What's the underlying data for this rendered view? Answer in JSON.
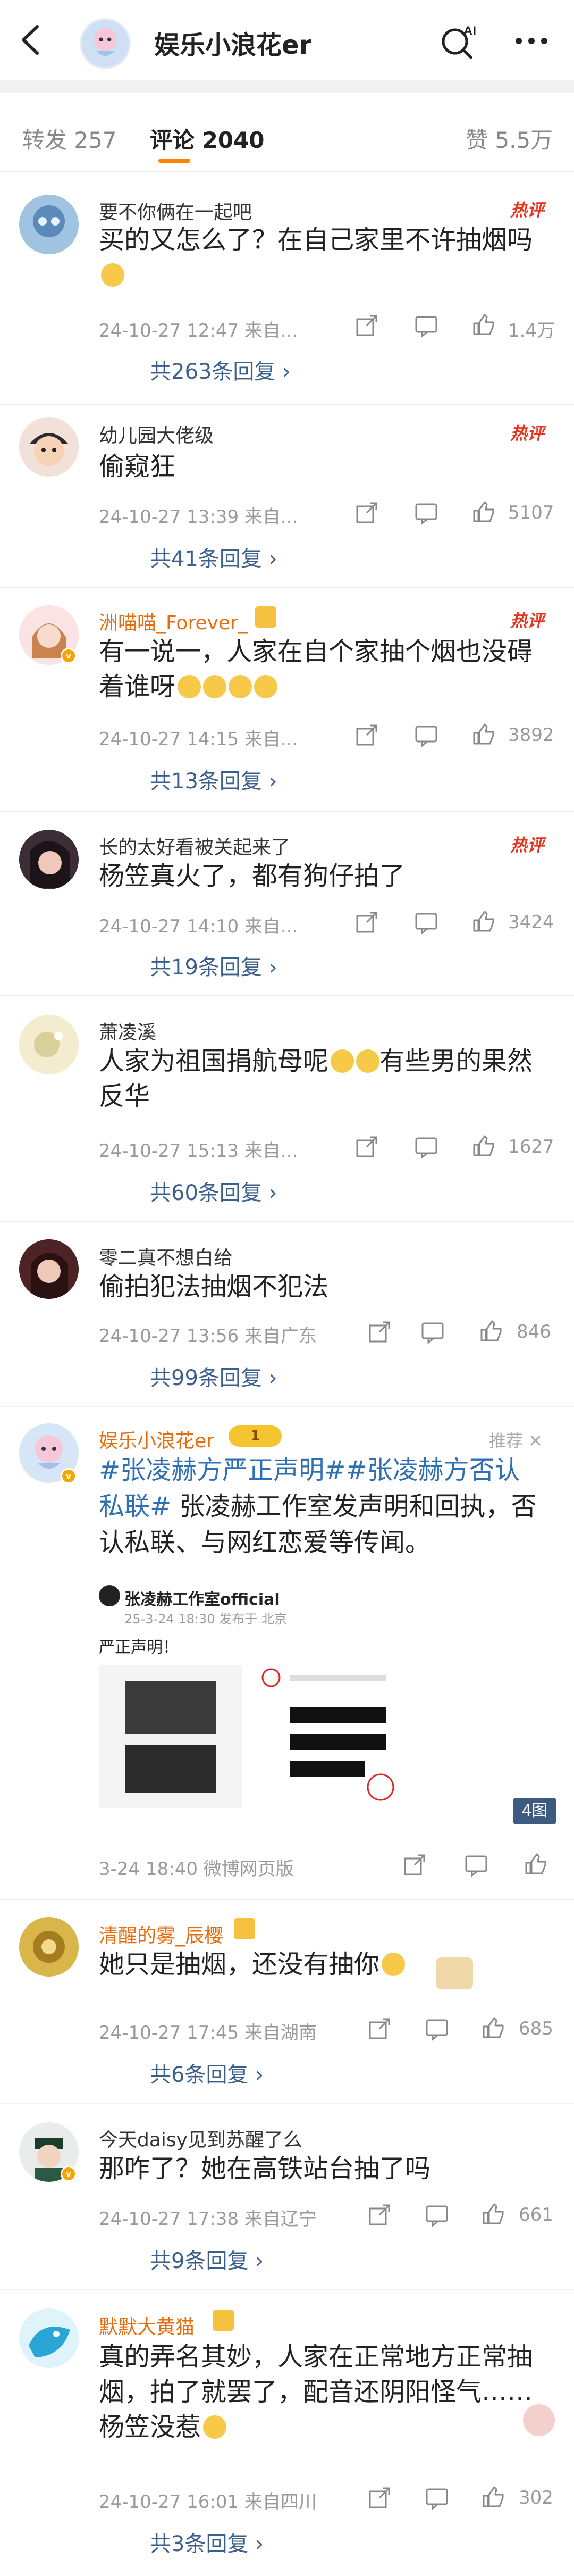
{
  "header": {
    "title": "娱乐小浪花er",
    "ai_label": "AI"
  },
  "tabs": [
    {
      "label": "转发 257"
    },
    {
      "label": "评论 2040"
    },
    {
      "label": "赞 5.5万"
    }
  ],
  "hot_label": "热评",
  "comments": [
    {
      "name": "要不你俩在一起吧",
      "text": "买的又怎么了？在自己家里不许抽烟吗",
      "meta": "24-10-27 12:47  来自...",
      "likes": "1.4万",
      "replies": "共263条回复 ›"
    },
    {
      "name": "幼儿园大佬级",
      "text": "偷窥狂",
      "meta": "24-10-27 13:39  来自...",
      "likes": "5107",
      "replies": "共41条回复 ›"
    },
    {
      "name": "洲喵喵_Forever_",
      "text": "有一说一，人家在自个家抽个烟也没碍着谁呀",
      "meta": "24-10-27 14:15  来自...",
      "likes": "3892",
      "replies": "共13条回复 ›"
    },
    {
      "name": "长的太好看被关起来了",
      "text": "杨笠真火了，都有狗仔拍了",
      "meta": "24-10-27 14:10  来自...",
      "likes": "3424",
      "replies": "共19条回复 ›"
    },
    {
      "name": "萧凌溪",
      "text_a": "人家为祖国捐航母呢",
      "text_b": "有些男的果然反华",
      "meta": "24-10-27 15:13  来自...",
      "likes": "1627",
      "replies": "共60条回复 ›"
    },
    {
      "name": "零二真不想白给",
      "text": "偷拍犯法抽烟不犯法",
      "meta": "24-10-27 13:56  来自广东",
      "likes": "846",
      "replies": "共99条回复 ›"
    }
  ],
  "post": {
    "name": "娱乐小浪花er",
    "level": "1",
    "recommend": "推荐 ✕",
    "tag1": "#张凌赫方严正声明#",
    "tag2": "#张凌赫方否认私联#",
    "text": " 张凌赫工作室发声明和回执，否认私联、与网红恋爱等传闻。",
    "embed_name": "张凌赫工作室official",
    "embed_meta": "25-3-24 18:30 发布于 北京",
    "embed_text": "严正声明！",
    "img_count": "4图",
    "meta": "3-24 18:40  微博网页版"
  },
  "comments2": [
    {
      "name": "清醒的雾_辰樱",
      "text": "她只是抽烟，还没有抽你",
      "meta": "24-10-27 17:45  来自湖南",
      "likes": "685",
      "replies": "共6条回复 ›"
    },
    {
      "name": "今天daisy见到苏醒了么",
      "text": "那咋了？她在高铁站台抽了吗",
      "meta": "24-10-27 17:38  来自辽宁",
      "likes": "661",
      "replies": "共9条回复 ›"
    },
    {
      "name": "默默大黄猫",
      "text": "真的弄名其妙，人家在正常地方正常抽烟，拍了就罢了，配音还阴阳怪气……杨笠没惹",
      "meta": "24-10-27 16:01  来自四川",
      "likes": "302",
      "replies": "共3条回复 ›"
    }
  ]
}
